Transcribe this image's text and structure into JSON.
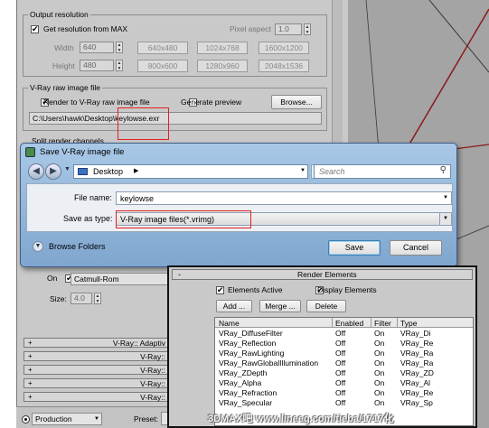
{
  "output_resolution": {
    "title": "Output resolution",
    "get_from_max_label": "Get resolution from MAX",
    "pixel_aspect_label": "Pixel aspect",
    "pixel_aspect_value": "1.0",
    "width_label": "Width",
    "width_value": "640",
    "height_label": "Height",
    "height_value": "480",
    "presets": [
      "640x480",
      "1024x768",
      "1600x1200",
      "800x600",
      "1280x960",
      "2048x1536"
    ]
  },
  "raw_image": {
    "title": "V-Ray raw image file",
    "render_to_label": "Render to V-Ray raw image file",
    "generate_preview_label": "Generate preview",
    "browse_label": "Browse...",
    "path_prefix": "C:\\Users\\hawk\\Desktop\\",
    "path_file": "keylowse.exr"
  },
  "split_channels": {
    "title": "Split render channels"
  },
  "dialog": {
    "title": "Save V-Ray image file",
    "location": "Desktop",
    "search_placeholder": "Search",
    "file_name_label": "File name:",
    "file_name_value": "keylowse",
    "save_type_label": "Save as type:",
    "save_type_value": "V-Ray image files(*.vrimg)",
    "browse_folders_label": "Browse Folders",
    "save_label": "Save",
    "cancel_label": "Cancel"
  },
  "filter": {
    "on_label": "On",
    "filter_value": "Catmull-Rom",
    "size_label": "Size:",
    "size_value": "4.0"
  },
  "rollouts": [
    "V-Ray:: Adaptiv",
    "V-Ray::",
    "V-Ray::",
    "V-Ray::",
    "V-Ray::"
  ],
  "bottom": {
    "mode_value": "Production",
    "preset_label": "Preset:"
  },
  "render_elements": {
    "title": "Render Elements",
    "collapse_symbol": "-",
    "elements_active_label": "Elements Active",
    "display_elements_label": "Display Elements",
    "add_label": "Add ...",
    "merge_label": "Merge ...",
    "delete_label": "Delete",
    "columns": [
      "Name",
      "Enabled",
      "Filter",
      "Type"
    ],
    "rows": [
      [
        "VRay_DiffuseFilter",
        "Off",
        "On",
        "VRay_Di"
      ],
      [
        "VRay_Reflection",
        "Off",
        "On",
        "VRay_Re"
      ],
      [
        "VRay_RawLighting",
        "Off",
        "On",
        "VRay_Ra"
      ],
      [
        "VRay_RawGlobalIllumination",
        "Off",
        "On",
        "VRay_Ra"
      ],
      [
        "VRay_ZDepth",
        "Off",
        "On",
        "VRay_ZD"
      ],
      [
        "VRay_Alpha",
        "Off",
        "On",
        "VRay_Al"
      ],
      [
        "VRay_Refraction",
        "Off",
        "On",
        "VRay_Re"
      ],
      [
        "VRay_Specular",
        "Off",
        "On",
        "VRay_Sp"
      ]
    ]
  },
  "watermark": "3DMAX吧 www.lineeg.com/tieba/1717化"
}
